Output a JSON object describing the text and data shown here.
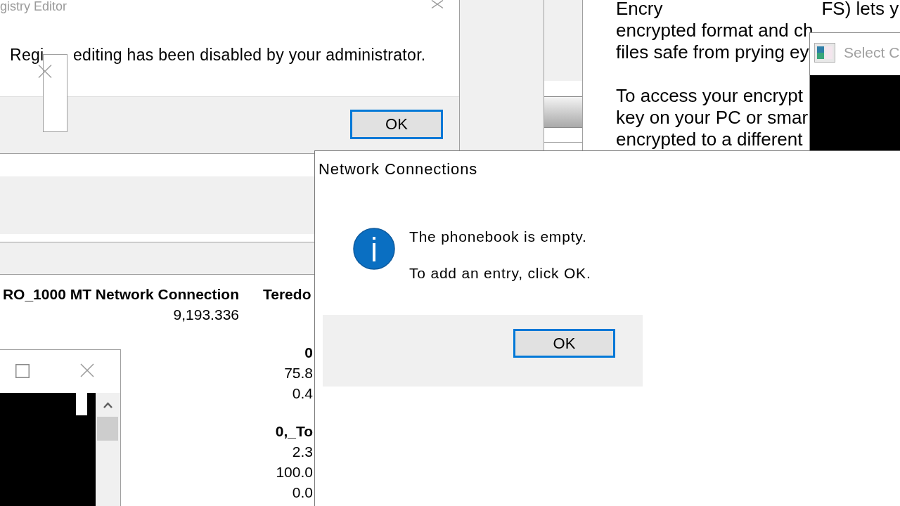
{
  "registry_dialog": {
    "title": "gistry Editor",
    "message_parts": [
      "Regi",
      "editing has been disabled by your administrator."
    ],
    "ok_button": "OK"
  },
  "encryption_text": {
    "paragraphs": [
      {
        "lines": [
          [
            "Encry",
            "FS) lets y"
          ],
          [
            "encrypted format and ch"
          ],
          [
            "files safe from prying ey"
          ]
        ]
      },
      {
        "lines": [
          [
            "To access your encrypt"
          ],
          [
            "key on your PC or smar"
          ],
          [
            "encrypted to a different"
          ]
        ]
      }
    ]
  },
  "select_window": {
    "title": "Select C"
  },
  "stats_window": {
    "column_1": {
      "header": "RO_1000 MT Network Connection",
      "cells": [
        {
          "text": "9,193.336",
          "kind": "value"
        }
      ]
    },
    "column_2": {
      "header": "Teredo",
      "cells": [
        {
          "text": "0",
          "kind": "heading"
        },
        {
          "text": "75.8",
          "kind": "value"
        },
        {
          "text": "0.4",
          "kind": "value"
        },
        {
          "text": "0,_To",
          "kind": "heading"
        },
        {
          "text": "2.3",
          "kind": "value"
        },
        {
          "text": "100.0",
          "kind": "value"
        },
        {
          "text": "0.0",
          "kind": "value"
        }
      ]
    }
  },
  "network_connections_dialog": {
    "title": "Network Connections",
    "messages": [
      "The phonebook is empty.",
      "To add an entry, click OK."
    ],
    "ok_button": "OK"
  }
}
